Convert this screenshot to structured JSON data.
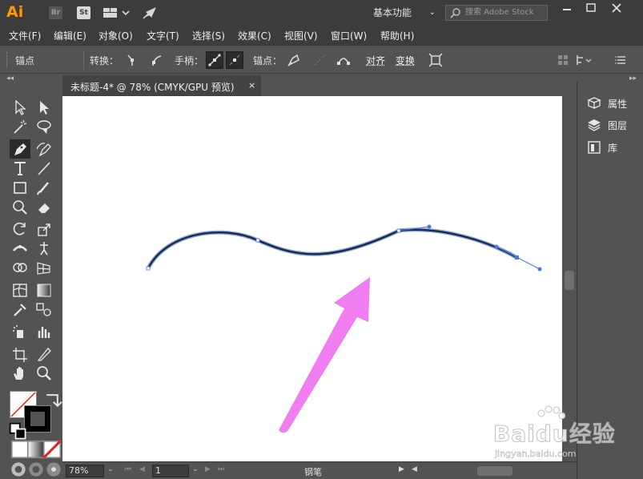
{
  "titlebar": {
    "logo": "Ai",
    "bridge_label": "Br",
    "stock_label": "St",
    "workspace": "基本功能",
    "search_placeholder": "搜索 Adobe Stock"
  },
  "menu": [
    "文件(F)",
    "编辑(E)",
    "对象(O)",
    "文字(T)",
    "选择(S)",
    "效果(C)",
    "视图(V)",
    "窗口(W)",
    "帮助(H)"
  ],
  "controlbar": {
    "anchor_title": "锚点",
    "convert_label": "转换：",
    "handle_label": "手柄：",
    "anchor_label": "锚点：",
    "align_label": "对齐",
    "transform_label": "变换"
  },
  "document": {
    "tab_title": "未标题-4* @ 78% (CMYK/GPU 预览)",
    "close_glyph": "×"
  },
  "statusbar": {
    "zoom": "78%",
    "artboard": "1",
    "current_tool": "钢笔"
  },
  "right_panel": {
    "items": [
      {
        "label": "属性",
        "icon": "properties-icon"
      },
      {
        "label": "图层",
        "icon": "layers-icon"
      },
      {
        "label": "库",
        "icon": "libraries-icon"
      }
    ]
  },
  "canvas": {
    "path_stroke_color": "#1b2a4a",
    "path_outline_color": "#8fa8d8",
    "arrow_color": "#f07ef0"
  },
  "watermark": {
    "text": "Baidu经验",
    "url": "jingyan.baidu.com"
  },
  "colors": {
    "ui_dark": "#3c3c3c",
    "ui_panel": "#535353",
    "accent_logo": "#ff9a00"
  }
}
